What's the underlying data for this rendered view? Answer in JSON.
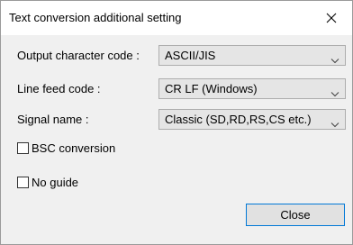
{
  "window": {
    "title": "Text conversion additional setting",
    "close_icon": "close-icon"
  },
  "fields": [
    {
      "label": "Output character code :",
      "value": "ASCII/JIS"
    },
    {
      "label": "Line feed code :",
      "value": "CR LF (Windows)"
    },
    {
      "label": "Signal name :",
      "value": "Classic (SD,RD,RS,CS etc.)"
    }
  ],
  "checkboxes": [
    {
      "label": "BSC conversion",
      "checked": false
    },
    {
      "label": "No guide",
      "checked": false
    }
  ],
  "buttons": {
    "close_label": "Close"
  },
  "colors": {
    "dialog_background": "#f0f0f0",
    "titlebar_background": "#ffffff",
    "button_focus_border": "#0078d7"
  }
}
